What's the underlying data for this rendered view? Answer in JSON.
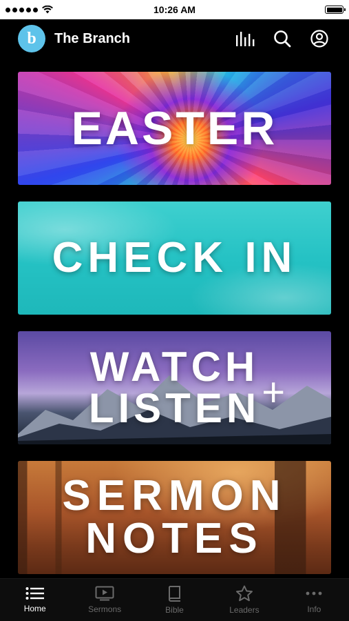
{
  "status_bar": {
    "time": "10:26 AM"
  },
  "header": {
    "logo_letter": "b",
    "app_title": "The Branch",
    "actions": [
      {
        "name": "audio-bars-icon"
      },
      {
        "name": "search-icon"
      },
      {
        "name": "profile-icon"
      }
    ]
  },
  "cards": {
    "easter": {
      "title": "EASTER"
    },
    "checkin": {
      "title": "CHECK IN"
    },
    "watch": {
      "line1": "WATCH",
      "plus": "+",
      "line2": "LISTEN"
    },
    "sermon": {
      "line1": "SERMON",
      "line2": "NOTES"
    }
  },
  "tabs": [
    {
      "label": "Home",
      "icon": "list-icon",
      "active": true
    },
    {
      "label": "Sermons",
      "icon": "tv-play-icon",
      "active": false
    },
    {
      "label": "Bible",
      "icon": "book-icon",
      "active": false
    },
    {
      "label": "Leaders",
      "icon": "star-icon",
      "active": false
    },
    {
      "label": "Info",
      "icon": "more-dots-icon",
      "active": false
    }
  ],
  "colors": {
    "logo_bg": "#5ec3ea",
    "active_tab": "#ffffff",
    "inactive_tab": "#6b6b6b",
    "app_bg": "#000000"
  }
}
